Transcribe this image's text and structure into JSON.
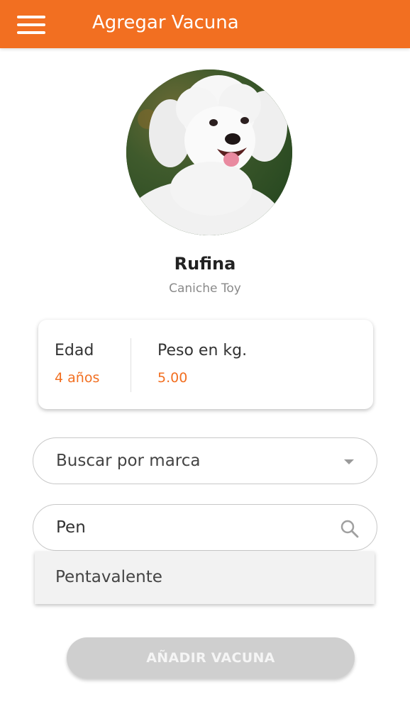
{
  "header": {
    "title": "Agregar Vacuna",
    "menu_icon": "hamburger-menu-icon",
    "background_color": "#f26f21"
  },
  "pet": {
    "name": "Rufina",
    "breed": "Caniche Toy",
    "photo": "white-poodle-photo"
  },
  "info": {
    "age_label": "Edad",
    "age_value": "4 años",
    "weight_label": "Peso en kg.",
    "weight_value": "5.00",
    "value_color": "#f26f21"
  },
  "brand_select": {
    "placeholder": "Buscar por marca",
    "icon": "dropdown-caret-icon"
  },
  "search": {
    "value": "Pen",
    "icon": "search-icon"
  },
  "suggestions": [
    {
      "label": "Pentavalente"
    }
  ],
  "actions": {
    "add_label": "AÑADIR VACUNA"
  }
}
